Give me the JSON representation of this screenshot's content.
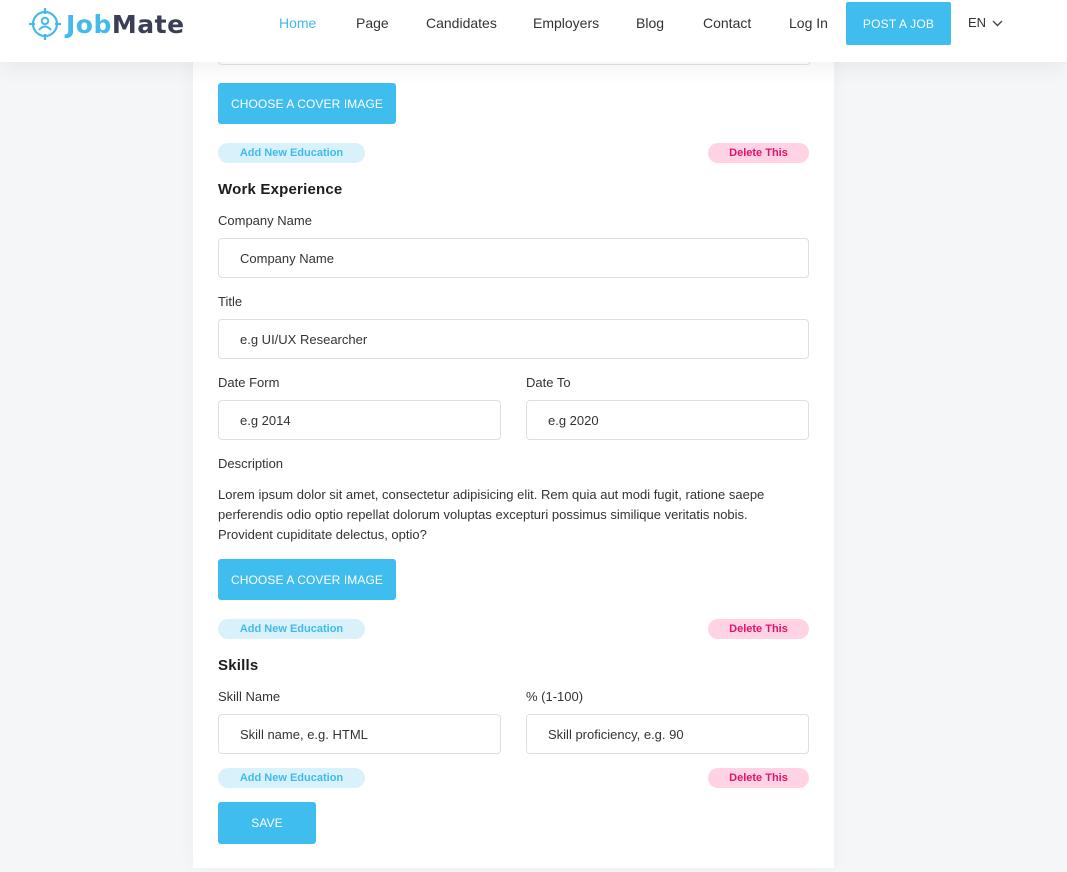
{
  "header": {
    "logo_job": "Job",
    "logo_mate": "Mate",
    "nav": [
      {
        "label": "Home",
        "active": true
      },
      {
        "label": "Page"
      },
      {
        "label": "Candidates"
      },
      {
        "label": "Employers"
      },
      {
        "label": "Blog"
      },
      {
        "label": "Contact"
      },
      {
        "label": "Log In"
      }
    ],
    "post_job": "POST A JOB",
    "lang": "EN"
  },
  "education_tail": {
    "cover_button": "CHOOSE A COVER IMAGE",
    "add_label": "Add New Education",
    "delete_label": "Delete This"
  },
  "work": {
    "title": "Work Experience",
    "company_label": "Company Name",
    "company_placeholder": "Company Name",
    "title_label": "Title",
    "title_placeholder": "e.g UI/UX Researcher",
    "date_from_label": "Date Form",
    "date_from_placeholder": "e.g 2014",
    "date_to_label": "Date To",
    "date_to_placeholder": "e.g 2020",
    "description_label": "Description",
    "description": "Lorem ipsum dolor sit amet, consectetur adipisicing elit. Rem quia aut modi fugit, ratione saepe perferendis odio optio repellat dolorum voluptas excepturi possimus similique veritatis nobis. Provident cupiditate delectus, optio?",
    "cover_button": "CHOOSE A COVER IMAGE",
    "add_label": "Add New Education",
    "delete_label": "Delete This"
  },
  "skills": {
    "title": "Skills",
    "skill_name_label": "Skill Name",
    "skill_name_placeholder": "Skill name, e.g. HTML",
    "percent_label": "% (1-100)",
    "percent_placeholder": "Skill proficiency, e.g. 90",
    "add_label": "Add New Education",
    "delete_label": "Delete This"
  },
  "save_label": "SAVE",
  "colors": {
    "accent": "#3ebdee",
    "delete_bg": "#ffd3e4",
    "delete_text": "#e0136c",
    "add_bg": "#d8f1fb"
  },
  "icons": {
    "logo": "target-person-icon",
    "lang_caret": "chevron-down-icon"
  }
}
